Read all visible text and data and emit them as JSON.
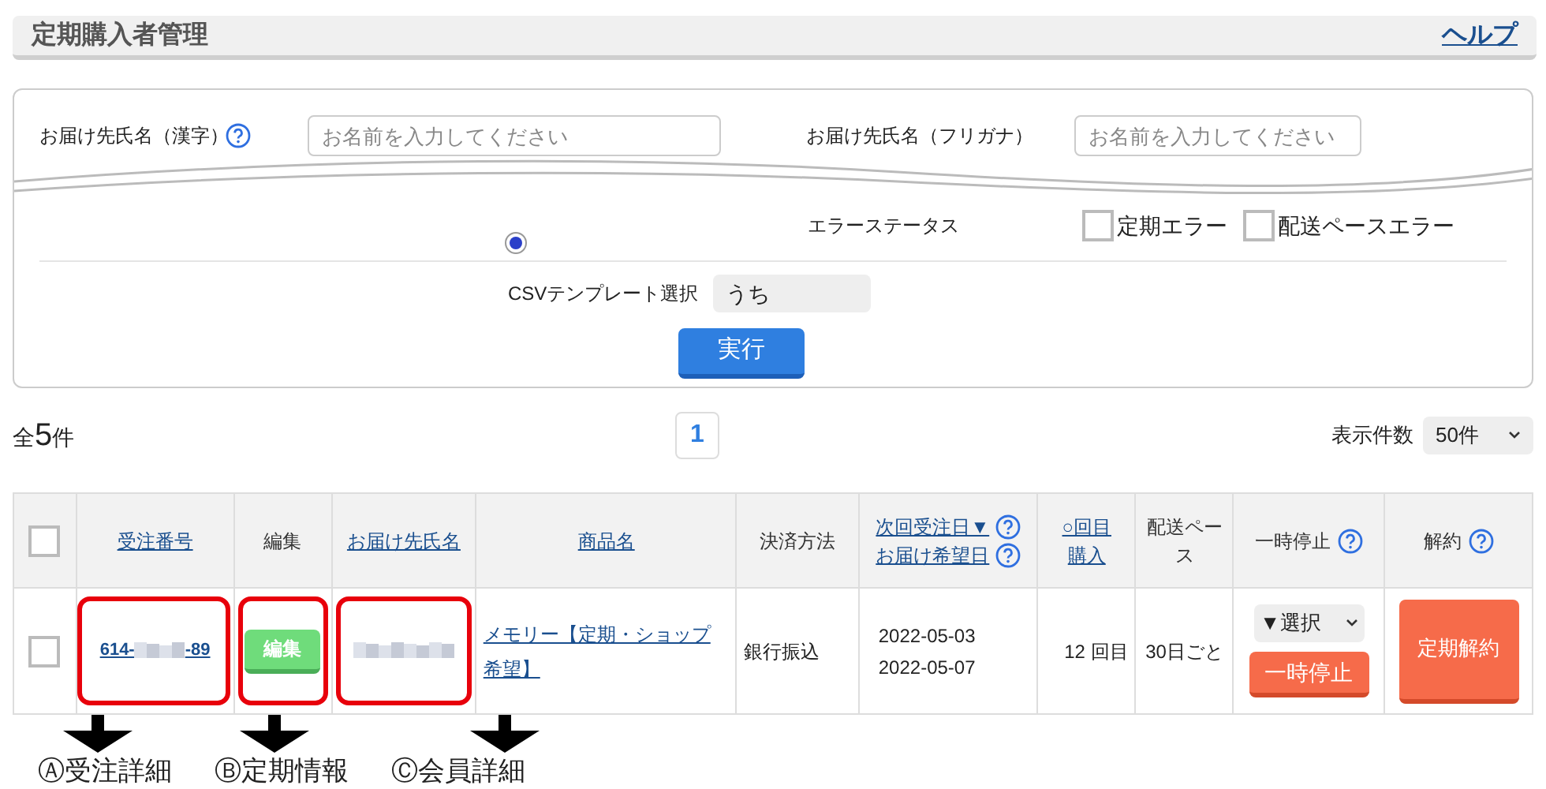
{
  "header": {
    "title": "定期購入者管理",
    "help": "ヘルプ"
  },
  "search": {
    "name_fields": [
      {
        "label": "お届け先氏名（漢字）",
        "help": true,
        "placeholder": "お名前を入力してください"
      },
      {
        "label": "お届け先氏名（フリガナ）",
        "help": false,
        "placeholder": "お名前を入力してください"
      }
    ],
    "error_status": {
      "label": "エラーステータス",
      "options": [
        {
          "label": "定期エラー",
          "checked": false
        },
        {
          "label": "配送ペースエラー",
          "checked": false
        }
      ]
    },
    "radio": {
      "selected": true
    },
    "csv": {
      "label": "CSVテンプレート選択",
      "value": "うち"
    },
    "submit": "実行"
  },
  "summary": {
    "prefix": "全",
    "count": "5",
    "suffix": "件"
  },
  "pagination": [
    {
      "label": "1",
      "selected": true
    }
  ],
  "per_page": {
    "label": "表示件数",
    "value": "50件"
  },
  "table": {
    "columns": [
      {
        "kind": "checkbox",
        "checked": false
      },
      {
        "kind": "text",
        "link": true,
        "lines": [
          {
            "text": "受注番号",
            "help": false
          }
        ]
      },
      {
        "kind": "text",
        "link": false,
        "lines": [
          {
            "text": "編集",
            "help": false
          }
        ]
      },
      {
        "kind": "text",
        "link": true,
        "lines": [
          {
            "text": "お届け先氏名",
            "help": false
          }
        ]
      },
      {
        "kind": "text",
        "link": true,
        "lines": [
          {
            "text": "商品名",
            "help": false
          }
        ]
      },
      {
        "kind": "text",
        "link": false,
        "lines": [
          {
            "text": "決済方法",
            "help": false
          }
        ]
      },
      {
        "kind": "text",
        "link": true,
        "lines": [
          {
            "text": "次回受注日▼",
            "help": true
          },
          {
            "text": "お届け希望日",
            "help": true
          }
        ]
      },
      {
        "kind": "text",
        "link": true,
        "lines": [
          {
            "text": "○回目",
            "help": false
          },
          {
            "text": "購入",
            "help": false
          }
        ]
      },
      {
        "kind": "text",
        "link": false,
        "lines": [
          {
            "text": "配送ペース",
            "help": false
          }
        ]
      },
      {
        "kind": "text",
        "link": false,
        "lines": [
          {
            "text": "一時停止",
            "help": true
          }
        ]
      },
      {
        "kind": "text",
        "link": false,
        "lines": [
          {
            "text": "解約",
            "help": true
          }
        ]
      }
    ],
    "rows": [
      {
        "checked": false,
        "order_prefix": "614-",
        "order_suffix": "-89",
        "edit": "編集",
        "product": "メモリー【定期・ショップ希望】",
        "payment": "銀行振込",
        "dates": [
          "2022-05-03",
          "2022-05-07"
        ],
        "count": "12 回目",
        "pace": "30日ごと",
        "pause_select": "▼選択",
        "pause_button": "一時停止",
        "cancel_button": "定期解約"
      }
    ]
  },
  "annotations": [
    {
      "label": "Ⓐ受注詳細"
    },
    {
      "label": "Ⓑ定期情報"
    },
    {
      "label": "Ⓒ会員詳細"
    }
  ]
}
